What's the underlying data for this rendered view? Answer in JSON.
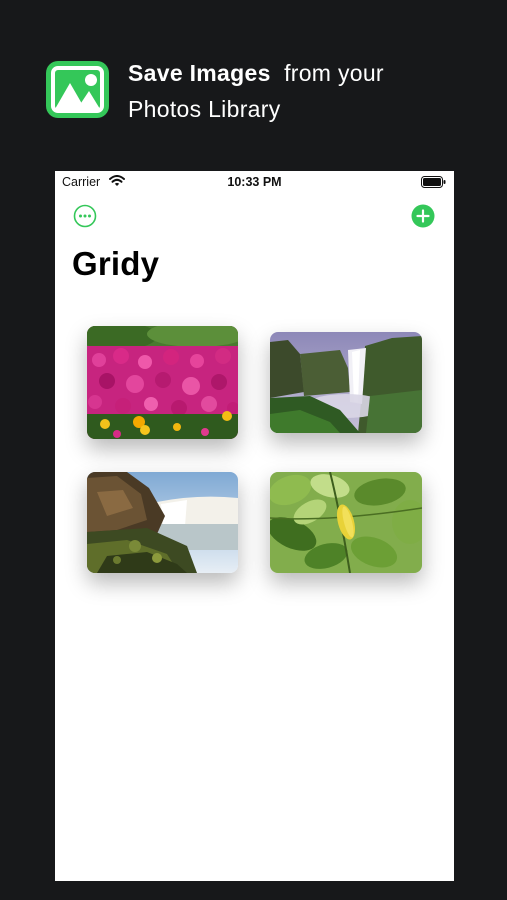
{
  "promo": {
    "headline_bold": "Save Images",
    "headline_rest": "from your",
    "headline_line2": "Photos Library",
    "icon": "photo-icon",
    "accent_color": "#34c759"
  },
  "status_bar": {
    "carrier": "Carrier",
    "time": "10:33 PM",
    "wifi_icon": "wifi-icon",
    "battery_icon": "battery-icon"
  },
  "nav": {
    "more_icon": "ellipsis-circle-icon",
    "add_icon": "plus-circle-icon",
    "tint_color": "#34c759"
  },
  "page": {
    "title": "Gridy"
  },
  "photos": [
    {
      "subject": "pink flowers"
    },
    {
      "subject": "waterfall with cliffs"
    },
    {
      "subject": "waterfall over rocky shore"
    },
    {
      "subject": "green leaves"
    }
  ]
}
